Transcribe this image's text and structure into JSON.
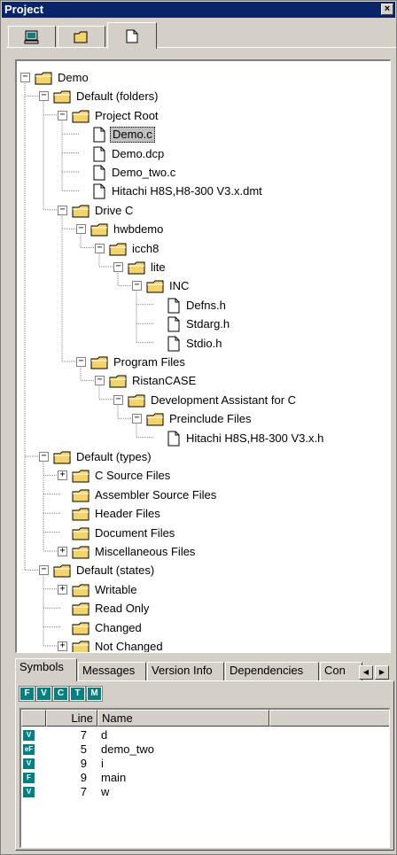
{
  "window": {
    "title": "Project",
    "close_glyph": "×"
  },
  "top_tabs": [
    {
      "icon": "computer-icon"
    },
    {
      "icon": "folder-icon"
    },
    {
      "icon": "file-icon",
      "active": true
    }
  ],
  "tree": [
    {
      "label": "Demo",
      "depth": 0,
      "kind": "folder",
      "exp": "-"
    },
    {
      "label": "Default (folders)",
      "depth": 1,
      "kind": "folder",
      "exp": "-"
    },
    {
      "label": "Project Root",
      "depth": 2,
      "kind": "folder",
      "exp": "-"
    },
    {
      "label": "Demo.c",
      "depth": 3,
      "kind": "file",
      "selected": true
    },
    {
      "label": "Demo.dcp",
      "depth": 3,
      "kind": "file"
    },
    {
      "label": "Demo_two.c",
      "depth": 3,
      "kind": "file"
    },
    {
      "label": "Hitachi H8S,H8-300 V3.x.dmt",
      "depth": 3,
      "kind": "file"
    },
    {
      "label": "Drive C",
      "depth": 2,
      "kind": "folder",
      "exp": "-"
    },
    {
      "label": "hwbdemo",
      "depth": 3,
      "kind": "folder",
      "exp": "-"
    },
    {
      "label": "icch8",
      "depth": 4,
      "kind": "folder",
      "exp": "-"
    },
    {
      "label": "lite",
      "depth": 5,
      "kind": "folder",
      "exp": "-"
    },
    {
      "label": "INC",
      "depth": 6,
      "kind": "folder",
      "exp": "-"
    },
    {
      "label": "Defns.h",
      "depth": 7,
      "kind": "file"
    },
    {
      "label": "Stdarg.h",
      "depth": 7,
      "kind": "file"
    },
    {
      "label": "Stdio.h",
      "depth": 7,
      "kind": "file"
    },
    {
      "label": "Program Files",
      "depth": 3,
      "kind": "folder",
      "exp": "-"
    },
    {
      "label": "RistanCASE",
      "depth": 4,
      "kind": "folder",
      "exp": "-"
    },
    {
      "label": "Development Assistant for C",
      "depth": 5,
      "kind": "folder",
      "exp": "-"
    },
    {
      "label": "Preinclude Files",
      "depth": 6,
      "kind": "folder",
      "exp": "-"
    },
    {
      "label": "Hitachi H8S,H8-300 V3.x.h",
      "depth": 7,
      "kind": "file"
    },
    {
      "label": "Default (types)",
      "depth": 1,
      "kind": "folder",
      "exp": "-"
    },
    {
      "label": "C Source Files",
      "depth": 2,
      "kind": "folder",
      "exp": "+"
    },
    {
      "label": "Assembler Source Files",
      "depth": 2,
      "kind": "folder"
    },
    {
      "label": "Header Files",
      "depth": 2,
      "kind": "folder"
    },
    {
      "label": "Document Files",
      "depth": 2,
      "kind": "folder"
    },
    {
      "label": "Miscellaneous Files",
      "depth": 2,
      "kind": "folder",
      "exp": "+"
    },
    {
      "label": "Default (states)",
      "depth": 1,
      "kind": "folder",
      "exp": "-"
    },
    {
      "label": "Writable",
      "depth": 2,
      "kind": "folder",
      "exp": "+"
    },
    {
      "label": "Read Only",
      "depth": 2,
      "kind": "folder"
    },
    {
      "label": "Changed",
      "depth": 2,
      "kind": "folder"
    },
    {
      "label": "Not Changed",
      "depth": 2,
      "kind": "folder",
      "exp": "+"
    }
  ],
  "bottom_tabs": [
    {
      "label": "Symbols",
      "active": true
    },
    {
      "label": "Messages"
    },
    {
      "label": "Version Info"
    },
    {
      "label": "Dependencies"
    },
    {
      "label": "Con"
    }
  ],
  "filters": [
    "F",
    "V",
    "C",
    "T",
    "M"
  ],
  "symbols": {
    "columns": [
      "Line",
      "Name"
    ],
    "rows": [
      {
        "icon": "V",
        "line": "7",
        "name": "d"
      },
      {
        "icon": "eF",
        "line": "5",
        "name": "demo_two"
      },
      {
        "icon": "V",
        "line": "9",
        "name": "i"
      },
      {
        "icon": "F",
        "line": "9",
        "name": "main"
      },
      {
        "icon": "V",
        "line": "7",
        "name": "w"
      }
    ]
  },
  "colors": {
    "title_bg": "#0a246a",
    "folder": "#f4d468",
    "symbol_icon": "#008080",
    "selection": "#c0c0c0"
  }
}
